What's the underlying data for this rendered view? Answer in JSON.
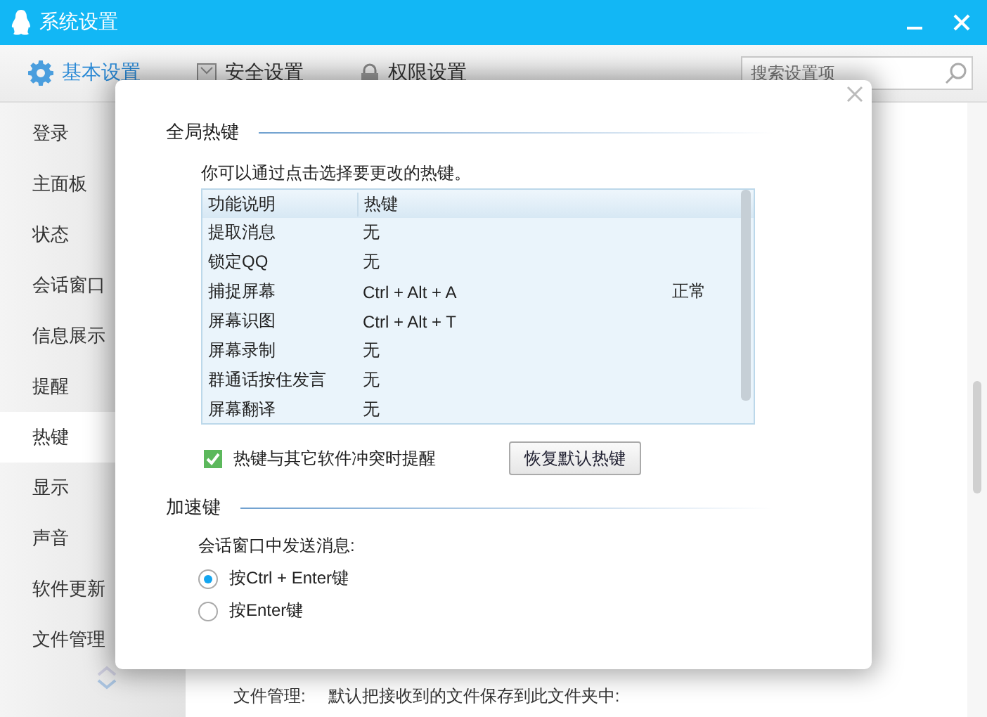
{
  "window": {
    "title": "系统设置"
  },
  "tabs": [
    {
      "label": "基本设置",
      "selected": true,
      "kind": "gear"
    },
    {
      "label": "安全设置",
      "selected": false,
      "kind": "frame"
    },
    {
      "label": "权限设置",
      "selected": false,
      "kind": "lock"
    }
  ],
  "search": {
    "placeholder": "搜索设置项"
  },
  "sidebar": {
    "items": [
      {
        "label": "登录",
        "selected": false
      },
      {
        "label": "主面板",
        "selected": false
      },
      {
        "label": "状态",
        "selected": false
      },
      {
        "label": "会话窗口",
        "selected": false
      },
      {
        "label": "信息展示",
        "selected": false
      },
      {
        "label": "提醒",
        "selected": false
      },
      {
        "label": "热键",
        "selected": true
      },
      {
        "label": "显示",
        "selected": false
      },
      {
        "label": "声音",
        "selected": false
      },
      {
        "label": "软件更新",
        "selected": false
      },
      {
        "label": "文件管理",
        "selected": false
      }
    ]
  },
  "background_row": {
    "label": "文件管理:",
    "text": "默认把接收到的文件保存到此文件夹中:"
  },
  "dialog": {
    "global_hotkeys": {
      "title": "全局热键",
      "hint": "你可以通过点击选择要更改的热键。",
      "table": {
        "columns": [
          "功能说明",
          "热键"
        ],
        "rows": [
          {
            "name": "提取消息",
            "hotkey": "无"
          },
          {
            "name": "锁定QQ",
            "hotkey": "无"
          },
          {
            "name": "捕捉屏幕",
            "hotkey": "Ctrl + Alt + A",
            "status": "正常"
          },
          {
            "name": "屏幕识图",
            "hotkey": "Ctrl + Alt + T"
          },
          {
            "name": "屏幕录制",
            "hotkey": "无"
          },
          {
            "name": "群通话按住发言",
            "hotkey": "无"
          },
          {
            "name": "屏幕翻译",
            "hotkey": "无"
          }
        ]
      },
      "conflict_check": {
        "label": "热键与其它软件冲突时提醒",
        "checked": true
      },
      "restore_button": "恢复默认热键"
    },
    "accelerator": {
      "title": "加速键",
      "prompt": "会话窗口中发送消息:",
      "options": [
        {
          "label": "按Ctrl + Enter键",
          "selected": true
        },
        {
          "label": "按Enter键",
          "selected": false
        }
      ]
    }
  }
}
